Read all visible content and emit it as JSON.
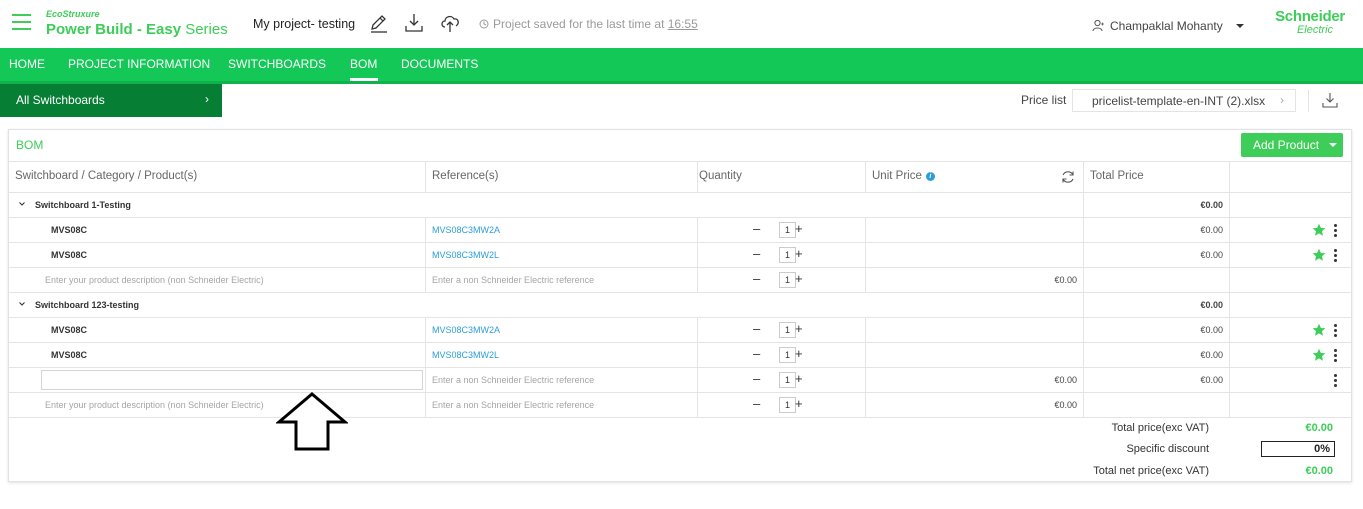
{
  "header": {
    "brand_small": "EcoStruxure",
    "brand_main": "Power Build - Easy",
    "brand_series": " Series",
    "project_name": "My project- testing",
    "save_status": "Project saved for the last time at ",
    "save_time": "16:55",
    "user_name": "Champaklal Mohanty",
    "logo_line1": "Schneider",
    "logo_line2": "Electric"
  },
  "nav": {
    "items": [
      "HOME",
      "PROJECT INFORMATION",
      "SWITCHBOARDS",
      "BOM",
      "DOCUMENTS"
    ],
    "active": "BOM"
  },
  "sidebar": {
    "all_switchboards": "All Switchboards"
  },
  "pricelist": {
    "label": "Price list",
    "value": "pricelist-template-en-INT (2).xlsx"
  },
  "bom": {
    "title": "BOM",
    "add_product": "Add Product",
    "columns": {
      "product": "Switchboard / Category / Product(s)",
      "reference": "Reference(s)",
      "quantity": "Quantity",
      "unit_price": "Unit Price",
      "total_price": "Total Price"
    },
    "groups": [
      {
        "name": "Switchboard 1-Testing",
        "total": "€0.00",
        "rows": [
          {
            "product": "MVS08C",
            "reference": "MVS08C3MW2A",
            "qty": "1",
            "unit": "",
            "total": "€0.00",
            "star": true,
            "menu": true
          },
          {
            "product": "MVS08C",
            "reference": "MVS08C3MW2L",
            "qty": "1",
            "unit": "",
            "total": "€0.00",
            "star": true,
            "menu": true
          },
          {
            "product_placeholder": "Enter your product description (non Schneider Electric)",
            "reference_placeholder": "Enter a non Schneider Electric reference",
            "qty": "1",
            "unit": "€0.00",
            "total": ""
          }
        ]
      },
      {
        "name": "Switchboard 123-testing",
        "total": "€0.00",
        "rows": [
          {
            "product": "MVS08C",
            "reference": "MVS08C3MW2A",
            "qty": "1",
            "unit": "",
            "total": "€0.00",
            "star": true,
            "menu": true
          },
          {
            "product": "MVS08C",
            "reference": "MVS08C3MW2L",
            "qty": "1",
            "unit": "",
            "total": "€0.00",
            "star": true,
            "menu": true
          },
          {
            "product_input": "",
            "reference_placeholder": "Enter a non Schneider Electric reference",
            "qty": "1",
            "unit": "€0.00",
            "total": "€0.00",
            "menu": true
          },
          {
            "product_placeholder": "Enter your product description (non Schneider Electric)",
            "reference_placeholder": "Enter a non Schneider Electric reference",
            "qty": "1",
            "unit": "€0.00",
            "total": ""
          }
        ]
      }
    ],
    "summary": {
      "total_label": "Total price(exc VAT)",
      "total_value": "€0.00",
      "discount_label": "Specific discount",
      "discount_value": "0%",
      "net_label": "Total net price(exc VAT)",
      "net_value": "€0.00"
    }
  },
  "qty_minus": "–",
  "qty_plus": "+",
  "colors": {
    "accent": "#3dcd58",
    "nav": "#14c858",
    "sidebar": "#067e34",
    "link": "#2b9ed8"
  }
}
